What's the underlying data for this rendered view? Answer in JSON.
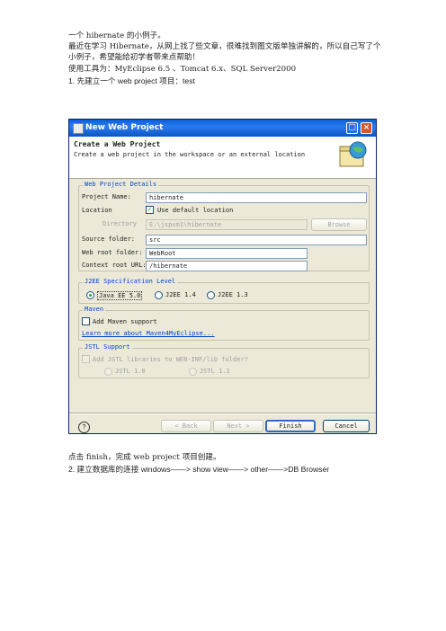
{
  "intro": {
    "line1": "一个 hibernate 的小例子。",
    "line2": "最近在学习 Hibernate，从网上找了些文章，很难找到图文版单独讲解的，所以自己写了个",
    "line3": "小例子，希望能给初学者带来点帮助！",
    "line4": "使用工具为：MyEclipse 6.5 、Tomcat 6.x、SQL Server2000",
    "step1": "1.    先建立一个 web project 项目：test"
  },
  "dialog": {
    "title": "New Web Project",
    "banner_title": "Create a Web Project",
    "banner_desc": "Create a web project in the workspace or an external location",
    "details_title": "Web Project Details",
    "project_name_label": "Project Name:",
    "project_name_value": "hibernate",
    "location_label": "Location",
    "use_default_label": "Use default location",
    "directory_label": "Directory",
    "directory_value": "E:\\jspxm1\\hibernate",
    "browse_label": "Browse",
    "source_folder_label": "Source folder:",
    "source_folder_value": "src",
    "web_root_label": "Web root folder:",
    "web_root_value": "WebRoot",
    "context_root_label": "Context root URL:",
    "context_root_value": "/hibernate",
    "j2ee_title": "J2EE Specification Level",
    "j2ee_options": [
      "Java EE 5.0",
      "J2EE 1.4",
      "J2EE 1.3"
    ],
    "maven_title": "Maven",
    "maven_checkbox": "Add Maven support",
    "maven_link": "Learn more about Maven4MyEclipse...",
    "jstl_title": "JSTL Support",
    "jstl_checkbox": "Add JSTL libraries to WEB-INF/lib folder?",
    "jstl_options": [
      "JSTL 1.0",
      "JSTL 1.1"
    ],
    "help_label": "?",
    "back_label": "< Back",
    "next_label": "Next >",
    "finish_label": "Finish",
    "cancel_label": "Cancel"
  },
  "after": {
    "line1": "点击 finish，完成 web project 项目创建。",
    "step2": "2.    建立数据库的连接   windows——> show view——> other——>DB Browser"
  },
  "colors": {
    "titlebar": "#0a5fd8",
    "dialog_bg": "#ece9d8",
    "group_title": "#0046d5"
  }
}
